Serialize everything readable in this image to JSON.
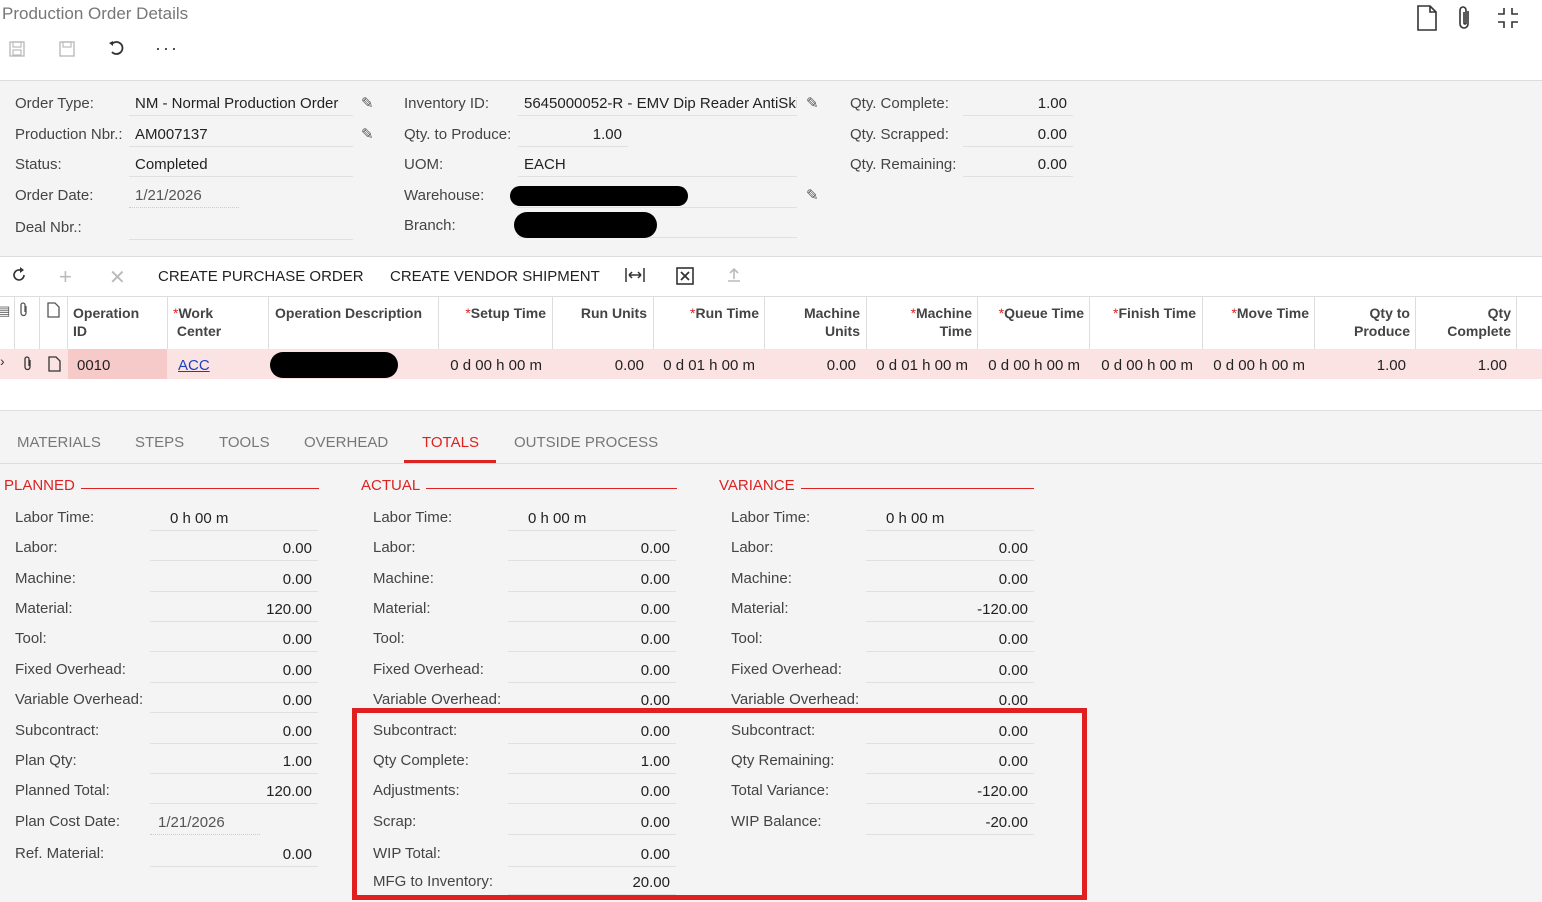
{
  "header": {
    "title": "Production Order Details",
    "toolbar_icons": [
      "save-draft-icon",
      "save-icon",
      "undo-icon",
      "more-icon"
    ],
    "right_icons": [
      "document-icon",
      "paperclip-icon",
      "collapse-icon"
    ]
  },
  "summary": {
    "order_type_label": "Order Type:",
    "order_type": "NM - Normal Production Order",
    "production_nbr_label": "Production Nbr.:",
    "production_nbr": "AM007137",
    "status_label": "Status:",
    "status": "Completed",
    "order_date_label": "Order Date:",
    "order_date": "1/21/2026",
    "deal_nbr_label": "Deal Nbr.:",
    "deal_nbr": "",
    "inventory_id_label": "Inventory ID:",
    "inventory_id": "5645000052-R - EMV Dip Reader AntiSki",
    "qty_to_produce_label": "Qty. to Produce:",
    "qty_to_produce": "1.00",
    "uom_label": "UOM:",
    "uom": "EACH",
    "warehouse_label": "Warehouse:",
    "branch_label": "Branch:",
    "qty_complete_label": "Qty. Complete:",
    "qty_complete": "1.00",
    "qty_scrapped_label": "Qty. Scrapped:",
    "qty_scrapped": "0.00",
    "qty_remaining_label": "Qty. Remaining:",
    "qty_remaining": "0.00"
  },
  "grid_toolbar": {
    "create_po": "CREATE PURCHASE ORDER",
    "create_vendor_shipment": "CREATE VENDOR SHIPMENT"
  },
  "grid": {
    "columns": [
      {
        "l1": "Operation",
        "l2": "ID",
        "req": false
      },
      {
        "l1": "Work",
        "l2": "Center",
        "req": true
      },
      {
        "l1": "Operation Description",
        "l2": "",
        "req": false
      },
      {
        "l1": "Setup Time",
        "l2": "",
        "req": true
      },
      {
        "l1": "Run Units",
        "l2": "",
        "req": false
      },
      {
        "l1": "Run Time",
        "l2": "",
        "req": true
      },
      {
        "l1": "Machine",
        "l2": "Units",
        "req": false
      },
      {
        "l1": "Machine",
        "l2": "Time",
        "req": true
      },
      {
        "l1": "Queue Time",
        "l2": "",
        "req": true
      },
      {
        "l1": "Finish Time",
        "l2": "",
        "req": true
      },
      {
        "l1": "Move Time",
        "l2": "",
        "req": true
      },
      {
        "l1": "Qty to",
        "l2": "Produce",
        "req": false
      },
      {
        "l1": "Qty",
        "l2": "Complete",
        "req": false
      }
    ],
    "row": {
      "operation_id": "0010",
      "work_center": "ACC",
      "setup_time": "0 d 00 h 00 m",
      "run_units": "0.00",
      "run_time": "0 d 01 h 00 m",
      "machine_units": "0.00",
      "machine_time": "0 d 01 h 00 m",
      "queue_time": "0 d 00 h 00 m",
      "finish_time": "0 d 00 h 00 m",
      "move_time": "0 d 00 h 00 m",
      "qty_to_produce": "1.00",
      "qty_complete": "1.00"
    }
  },
  "tabs": [
    "MATERIALS",
    "STEPS",
    "TOOLS",
    "OVERHEAD",
    "TOTALS",
    "OUTSIDE PROCESS"
  ],
  "active_tab": "TOTALS",
  "totals": {
    "planned": {
      "title": "PLANNED",
      "rows": [
        {
          "label": "Labor Time:",
          "value": "0 h 00 m",
          "align": "left"
        },
        {
          "label": "Labor:",
          "value": "0.00"
        },
        {
          "label": "Machine:",
          "value": "0.00"
        },
        {
          "label": "Material:",
          "value": "120.00"
        },
        {
          "label": "Tool:",
          "value": "0.00"
        },
        {
          "label": "Fixed Overhead:",
          "value": "0.00"
        },
        {
          "label": "Variable Overhead:",
          "value": "0.00"
        },
        {
          "label": "Subcontract:",
          "value": "0.00"
        },
        {
          "label": "Plan Qty:",
          "value": "1.00"
        },
        {
          "label": "Planned Total:",
          "value": "120.00"
        },
        {
          "label": "Plan Cost Date:",
          "value": "1/21/2026",
          "align": "left"
        },
        {
          "label": "Ref. Material:",
          "value": "0.00"
        }
      ]
    },
    "actual": {
      "title": "ACTUAL",
      "rows": [
        {
          "label": "Labor Time:",
          "value": "0 h 00 m",
          "align": "left"
        },
        {
          "label": "Labor:",
          "value": "0.00"
        },
        {
          "label": "Machine:",
          "value": "0.00"
        },
        {
          "label": "Material:",
          "value": "0.00"
        },
        {
          "label": "Tool:",
          "value": "0.00"
        },
        {
          "label": "Fixed Overhead:",
          "value": "0.00"
        },
        {
          "label": "Variable Overhead:",
          "value": "0.00"
        },
        {
          "label": "Subcontract:",
          "value": "0.00"
        },
        {
          "label": "Qty Complete:",
          "value": "1.00"
        },
        {
          "label": "Adjustments:",
          "value": "0.00"
        },
        {
          "label": "Scrap:",
          "value": "0.00"
        },
        {
          "label": "WIP Total:",
          "value": "0.00"
        },
        {
          "label": "MFG to Inventory:",
          "value": "20.00"
        }
      ]
    },
    "variance": {
      "title": "VARIANCE",
      "rows": [
        {
          "label": "Labor Time:",
          "value": "0 h 00 m",
          "align": "left"
        },
        {
          "label": "Labor:",
          "value": "0.00"
        },
        {
          "label": "Machine:",
          "value": "0.00"
        },
        {
          "label": "Material:",
          "value": "-120.00"
        },
        {
          "label": "Tool:",
          "value": "0.00"
        },
        {
          "label": "Fixed Overhead:",
          "value": "0.00"
        },
        {
          "label": "Variable Overhead:",
          "value": "0.00"
        },
        {
          "label": "Subcontract:",
          "value": "0.00"
        },
        {
          "label": "Qty Remaining:",
          "value": "0.00"
        },
        {
          "label": "Total Variance:",
          "value": "-120.00"
        },
        {
          "label": "WIP Balance:",
          "value": "-20.00"
        }
      ]
    }
  },
  "colors": {
    "accent": "#d22222",
    "highlight_box": "#e02020",
    "row_highlight": "#fbe3e3"
  }
}
